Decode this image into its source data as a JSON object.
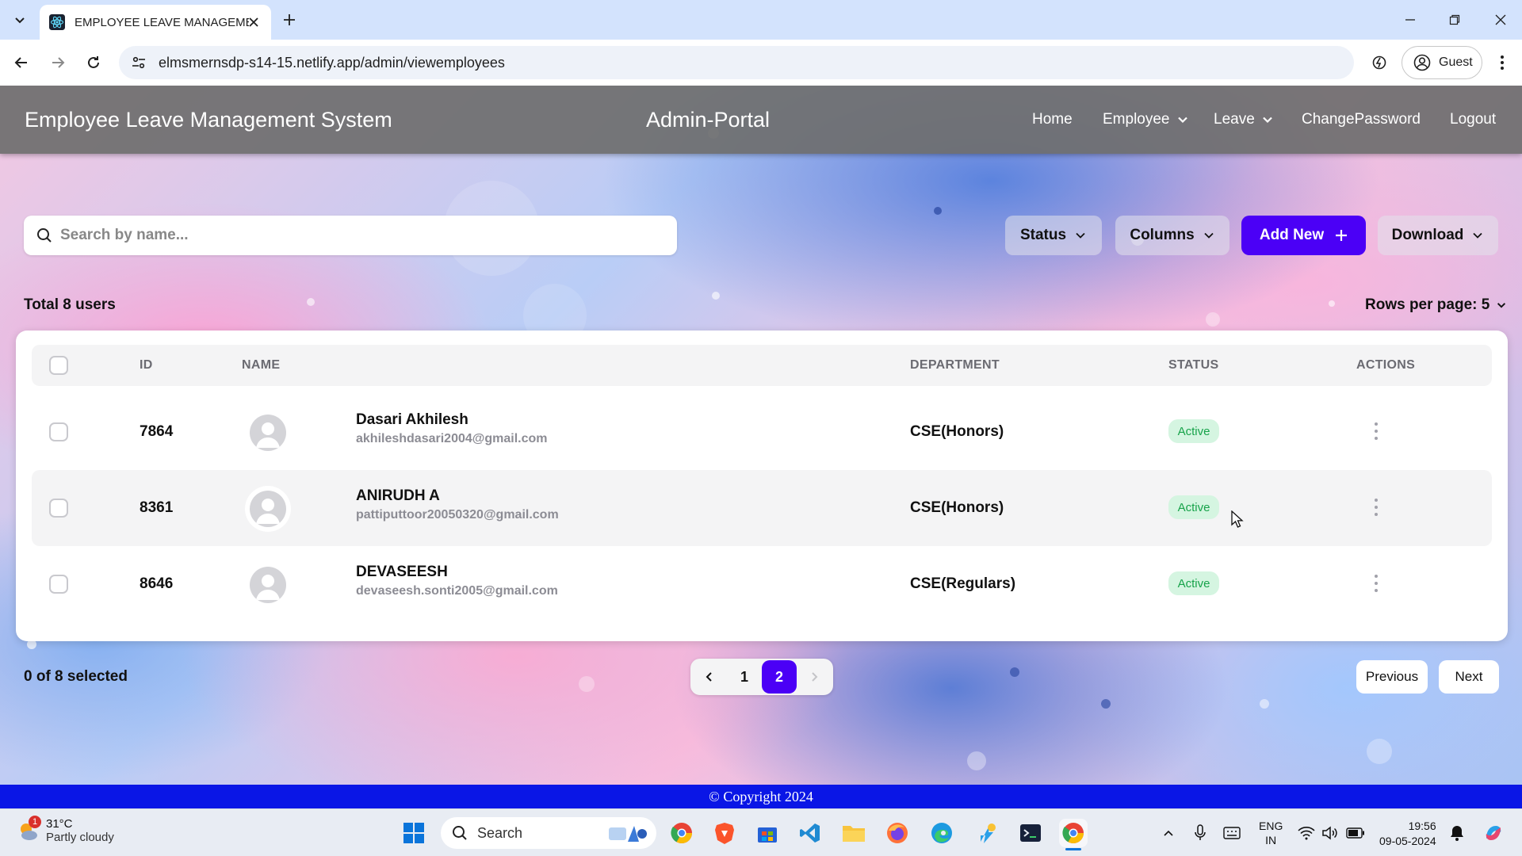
{
  "browser": {
    "tab_title": "EMPLOYEE LEAVE MANAGEMEN",
    "url": "elmsmernsdp-s14-15.netlify.app/admin/viewemployees",
    "profile_label": "Guest"
  },
  "header": {
    "brand": "Employee Leave Management System",
    "portal_title": "Admin-Portal",
    "nav": {
      "home": "Home",
      "employee": "Employee",
      "leave": "Leave",
      "change_password": "ChangePassword",
      "logout": "Logout"
    }
  },
  "toolbar": {
    "search_placeholder": "Search by name...",
    "status_label": "Status",
    "columns_label": "Columns",
    "add_new_label": "Add New",
    "download_label": "Download"
  },
  "summary": {
    "total_users": "Total 8 users",
    "rows_per_page": "Rows per page: 5"
  },
  "table": {
    "headers": {
      "id": "ID",
      "name": "NAME",
      "department": "DEPARTMENT",
      "status": "STATUS",
      "actions": "ACTIONS"
    },
    "rows": [
      {
        "id": "7864",
        "name": "Dasari Akhilesh",
        "email": "akhileshdasari2004@gmail.com",
        "department": "CSE(Honors)",
        "status": "Active"
      },
      {
        "id": "8361",
        "name": "ANIRUDH A",
        "email": "pattiputtoor20050320@gmail.com",
        "department": "CSE(Honors)",
        "status": "Active"
      },
      {
        "id": "8646",
        "name": "DEVASEESH",
        "email": "devaseesh.sonti2005@gmail.com",
        "department": "CSE(Regulars)",
        "status": "Active"
      }
    ]
  },
  "pagination": {
    "selected_text": "0 of 8 selected",
    "pages": [
      "1",
      "2"
    ],
    "current_page": "2",
    "previous_label": "Previous",
    "next_label": "Next"
  },
  "footer": {
    "copyright": "© Copyright 2024"
  },
  "taskbar": {
    "weather_temp": "31°C",
    "weather_condition": "Partly cloudy",
    "weather_badge": "1",
    "search_label": "Search",
    "lang_top": "ENG",
    "lang_bottom": "IN",
    "time": "19:56",
    "date": "09-05-2024"
  },
  "colors": {
    "accent": "#4b00f6",
    "header_bg": "#6e6e6e",
    "footer_bg": "#0a16e6",
    "status_active_bg": "#d5f5e1",
    "status_active_text": "#17a34a"
  }
}
